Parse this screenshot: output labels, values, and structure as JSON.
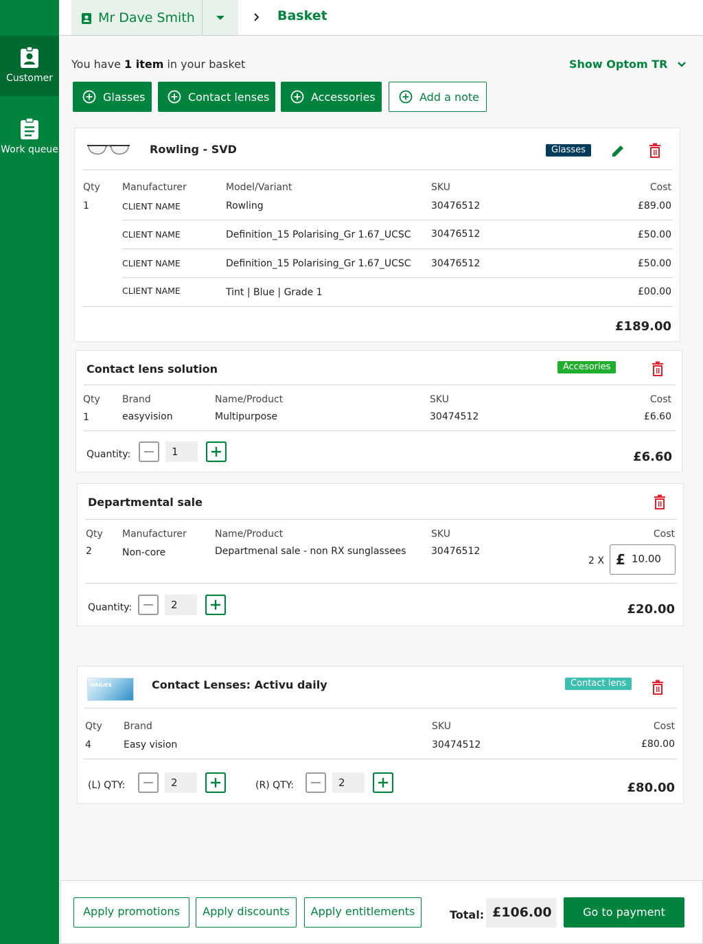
{
  "sidebar": {
    "items": [
      {
        "label": "Customer",
        "icon": "customer-badge-icon"
      },
      {
        "label": "Work queue",
        "icon": "clipboard-icon"
      }
    ]
  },
  "header": {
    "customer_name": "Mr Dave Smith",
    "page_title": "Basket"
  },
  "summary": {
    "prefix": "You have ",
    "count": "1 item",
    "suffix": " in your basket"
  },
  "show_optom": "Show Optom TR",
  "add_buttons": [
    "Glasses",
    "Contact lenses",
    "Accessories",
    "Add a note"
  ],
  "glasses_card": {
    "title": "Rowling - SVD",
    "badge": "Glasses",
    "badge_color": "#003b5c",
    "headers": {
      "qty": "Qty",
      "manufacturer": "Manufacturer",
      "model": "Model/Variant",
      "sku": "SKU",
      "cost": "Cost"
    },
    "qty": "1",
    "rows": [
      {
        "manufacturer": "CLIENT NAME",
        "model": "Rowling",
        "sku": "30476512",
        "cost": "£89.00"
      },
      {
        "manufacturer": "CLIENT NAME",
        "model": "Definition_15 Polarising_Gr 1.67_UCSC",
        "sku": "30476512",
        "cost": "£50.00"
      },
      {
        "manufacturer": "CLIENT NAME",
        "model": "Definition_15 Polarising_Gr 1.67_UCSC",
        "sku": "30476512",
        "cost": "£50.00"
      },
      {
        "manufacturer": "CLIENT NAME",
        "model": "Tint | Blue | Grade 1",
        "sku": "",
        "cost": "£00.00"
      }
    ],
    "total": "£189.00"
  },
  "solution_card": {
    "title": "Contact lens solution",
    "badge": "Accesories",
    "badge_color": "#1fae2e",
    "headers": {
      "qty": "Qty",
      "brand": "Brand",
      "product": "Name/Product",
      "sku": "SKU",
      "cost": "Cost"
    },
    "row": {
      "qty": "1",
      "brand": "easyvision",
      "product": "Multipurpose",
      "sku": "30474512",
      "cost": "£6.60"
    },
    "quantity_label": "Quantity:",
    "quantity_value": "1",
    "total": "£6.60"
  },
  "departmental_card": {
    "title": "Departmental sale",
    "headers": {
      "qty": "Qty",
      "manufacturer": "Manufacturer",
      "product": "Name/Product",
      "sku": "SKU",
      "cost": "Cost"
    },
    "row": {
      "qty": "2",
      "manufacturer": "Non-core",
      "product": "Departmenal sale - non RX sunglassees",
      "sku": "30476512"
    },
    "multiplier": "2 X",
    "currency_symbol": "£",
    "price_value": "10.00",
    "quantity_label": "Quantity:",
    "quantity_value": "2",
    "total": "£20.00"
  },
  "lens_card": {
    "title": "Contact Lenses: Activu daily",
    "badge": "Contact lens",
    "badge_color": "#3cbfae",
    "product_box_text": "DAILIES",
    "headers": {
      "qty": "Qty",
      "brand": "Brand",
      "sku": "SKU",
      "cost": "Cost"
    },
    "row": {
      "qty": "4",
      "brand": "Easy vision",
      "sku": "30474512",
      "cost": "£80.00"
    },
    "left_label": "(L) QTY:",
    "left_value": "2",
    "right_label": "(R) QTY:",
    "right_value": "2",
    "total": "£80.00"
  },
  "footer": {
    "apply_promotions": "Apply promotions",
    "apply_discounts": "Apply discounts",
    "apply_entitlements": "Apply entitlements",
    "total_label": "Total:",
    "total_value": "£106.00",
    "pay_button": "Go to payment"
  },
  "colors": {
    "brand_green": "#00843d",
    "sidebar_active": "#006a30",
    "delete_red": "#e0202a"
  }
}
